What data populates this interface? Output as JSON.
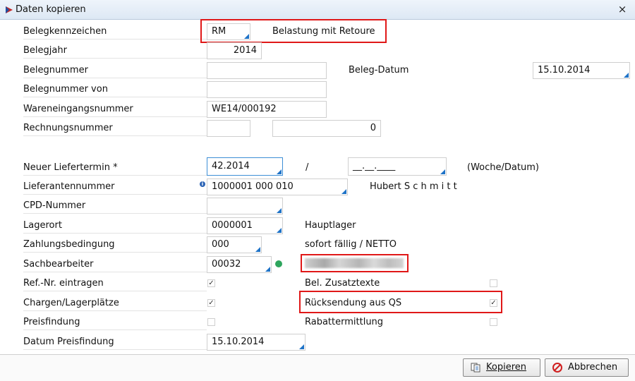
{
  "window": {
    "title": "Daten kopieren",
    "close": "×"
  },
  "labels": {
    "belegkennzeichen": "Belegkennzeichen",
    "belegjahr": "Belegjahr",
    "belegnummer": "Belegnummer",
    "belegnummer_von": "Belegnummer von",
    "wareneingangsnummer": "Wareneingangsnummer",
    "rechnungsnummer": "Rechnungsnummer",
    "neuer_liefertermin": "Neuer Liefertermin *",
    "lieferantennummer": "Lieferantennummer",
    "cpd_nummer": "CPD-Nummer",
    "lagerort": "Lagerort",
    "zahlungsbedingung": "Zahlungsbedingung",
    "sachbearbeiter": "Sachbearbeiter",
    "ref_nr": "Ref.-Nr. eintragen",
    "chargen": "Chargen/Lagerplätze",
    "preisfindung": "Preisfindung",
    "datum_preisfindung": "Datum Preisfindung",
    "beleg_datum": "Beleg-Datum",
    "bel_zusatztexte": "Bel. Zusatztexte",
    "ruecksendung": "Rücksendung aus QS",
    "rabattermittlung": "Rabattermittlung"
  },
  "values": {
    "belegkennzeichen": "RM",
    "belegkennzeichen_desc": "Belastung mit Retoure",
    "belegjahr": "2014",
    "belegnummer": "",
    "beleg_datum": "15.10.2014",
    "belegnummer_von": "",
    "wareneingangsnummer": "WE14/000192",
    "rechnungsnummer": "",
    "rechnungsbetrag": "0",
    "liefertermin_woche": "42.2014",
    "liefertermin_sep": "/",
    "liefertermin_datum": "__.__.____",
    "liefertermin_hint": "(Woche/Datum)",
    "lieferantennummer": "1000001 000 010",
    "lieferant_name": "Hubert S c h m i t t",
    "cpd_nummer": "",
    "lagerort": "0000001",
    "lagerort_desc": "Hauptlager",
    "zahlungsbedingung": "000",
    "zahlungsbedingung_desc": "sofort fällig / NETTO",
    "sachbearbeiter": "00032",
    "datum_preisfindung": "15.10.2014"
  },
  "checkboxes": {
    "ref_nr": true,
    "chargen": true,
    "preisfindung": false,
    "bel_zusatztexte": false,
    "ruecksendung": true,
    "rabattermittlung": false
  },
  "buttons": {
    "kopieren": "Kopieren",
    "abbrechen": "Abbrechen"
  },
  "colors": {
    "highlight": "#e01818",
    "accent": "#1f73c7",
    "status": "#2ea55d"
  }
}
